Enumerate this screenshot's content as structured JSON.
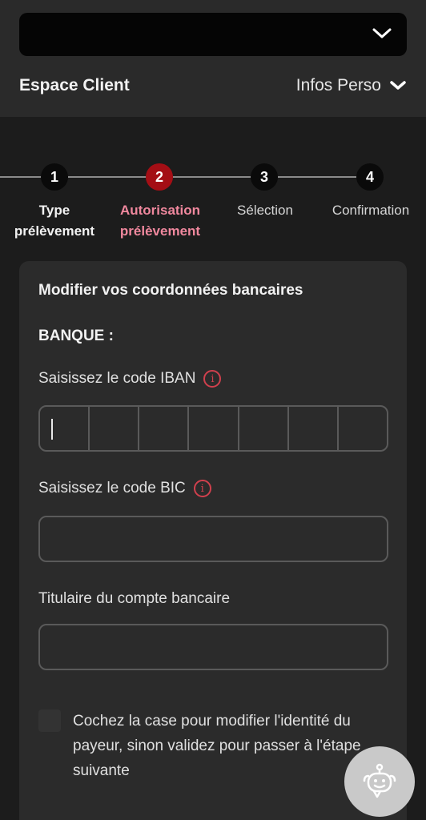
{
  "header": {
    "espace_client": "Espace Client",
    "infos_perso": "Infos Perso"
  },
  "stepper": {
    "steps": [
      {
        "number": "1",
        "label_line1": "Type",
        "label_line2": "prélèvement",
        "state": "done"
      },
      {
        "number": "2",
        "label_line1": "Autorisation",
        "label_line2": "prélèvement",
        "state": "active"
      },
      {
        "number": "3",
        "label_line1": "Sélection",
        "label_line2": "",
        "state": "pending"
      },
      {
        "number": "4",
        "label_line1": "Confirmation",
        "label_line2": "",
        "state": "pending"
      }
    ]
  },
  "form": {
    "title": "Modifier vos coordonnées bancaires",
    "section": "BANQUE :",
    "iban_label": "Saisissez le code IBAN",
    "bic_label": "Saisissez le code BIC",
    "holder_label": "Titulaire du compte bancaire",
    "iban_value": "",
    "bic_value": "",
    "holder_value": "",
    "checkbox_text": "Cochez la case pour modifier l'identité du payeur, sinon validez pour passer à l'étape suivante",
    "checkbox_checked": false
  },
  "icons": {
    "info": "info-icon",
    "chevron": "chevron-down-icon",
    "assistant": "chatbot-icon"
  },
  "colors": {
    "accent": "#a40e15",
    "active_label": "#f0889e",
    "info_icon": "#d0404d"
  }
}
